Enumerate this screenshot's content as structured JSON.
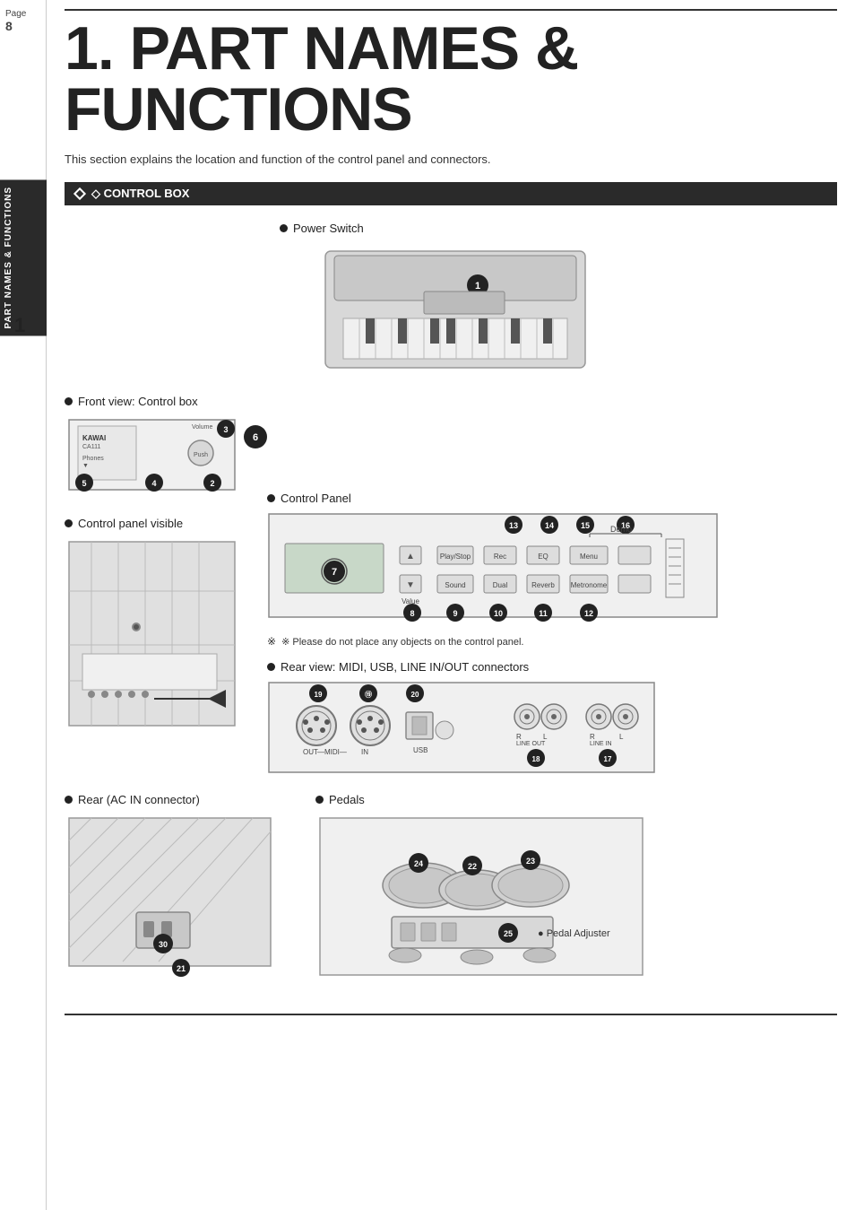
{
  "sidebar": {
    "page_label": "Page",
    "page_number": "8",
    "tab_text": "PART NAMES & FUNCTIONS",
    "section_number": "1"
  },
  "header": {
    "title": "1. PART NAMES & FUNCTIONS",
    "intro": "This section explains the location and function of the control panel and connectors."
  },
  "sections": {
    "control_box_label": "◇ CONTROL BOX",
    "power_switch_label": "Power Switch",
    "front_view_label": "Front view: Control box",
    "control_panel_visible_label": "Control panel visible",
    "control_panel_label": "Control Panel",
    "rear_view_label": "Rear view: MIDI, USB, LINE IN/OUT connectors",
    "rear_ac_label": "Rear (AC IN connector)",
    "pedals_label": "Pedals",
    "pedal_adjuster_label": "Pedal Adjuster",
    "note_text": "※ Please do not place any objects on the control panel."
  },
  "numbers": {
    "n1": "1",
    "n2": "2",
    "n3": "3",
    "n4": "4",
    "n5": "5",
    "n6": "6",
    "n7": "7",
    "n8": "8",
    "n9": "9",
    "n10": "10",
    "n11": "11",
    "n12": "12",
    "n13": "13",
    "n14": "14",
    "n15": "15",
    "n16": "16",
    "n17": "17",
    "n18": "18",
    "n19": "19",
    "n20": "20",
    "n21": "21",
    "n22": "22",
    "n23": "23",
    "n24": "24",
    "n25": "25",
    "n30": "30"
  },
  "control_panel_labels": {
    "value": "Value",
    "play_stop": "Play/Stop",
    "rec": "Rec",
    "eq": "EQ",
    "menu": "Menu",
    "sound": "Sound",
    "dual": "Dual",
    "reverb": "Reverb",
    "metronome": "Metronome",
    "demo": "Demo",
    "kawai_model": "KAWAI CA111",
    "phones": "Phones",
    "push": "Push"
  },
  "connector_labels": {
    "out": "OUT",
    "midi": "MIDI",
    "in": "IN",
    "usb": "USB",
    "line_out": "LINE OUT",
    "line_in": "LINE IN",
    "r": "R",
    "l": "L"
  }
}
